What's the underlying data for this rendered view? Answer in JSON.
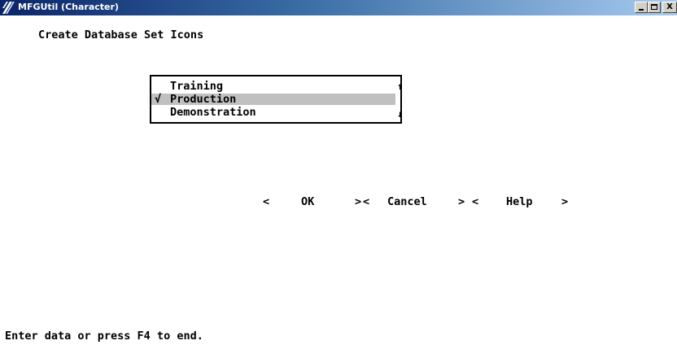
{
  "window": {
    "title": "MFGUtil (Character)",
    "controls": {
      "minimize": "_",
      "maximize": "□",
      "close": "X"
    }
  },
  "screen": {
    "heading": "Create Database Set Icons",
    "list": {
      "items": [
        {
          "label": "Training",
          "checked": false,
          "selected": false
        },
        {
          "label": "Production",
          "checked": true,
          "selected": true
        },
        {
          "label": "Demonstration",
          "checked": false,
          "selected": false
        }
      ],
      "check_mark": "√",
      "scroll_up": "↑",
      "scroll_down": "↓"
    },
    "buttons": {
      "ok": {
        "left": "<",
        "label": "OK",
        "right": ">"
      },
      "cancel": {
        "left": "<",
        "label": "Cancel",
        "right": ">"
      },
      "help": {
        "left": "<",
        "label": "Help",
        "right": ">"
      }
    },
    "status": "Enter data or press F4 to end."
  },
  "colors": {
    "selection": "#c0c0c0",
    "titlebar_start": "#0a246a",
    "titlebar_end": "#a6caf0"
  }
}
